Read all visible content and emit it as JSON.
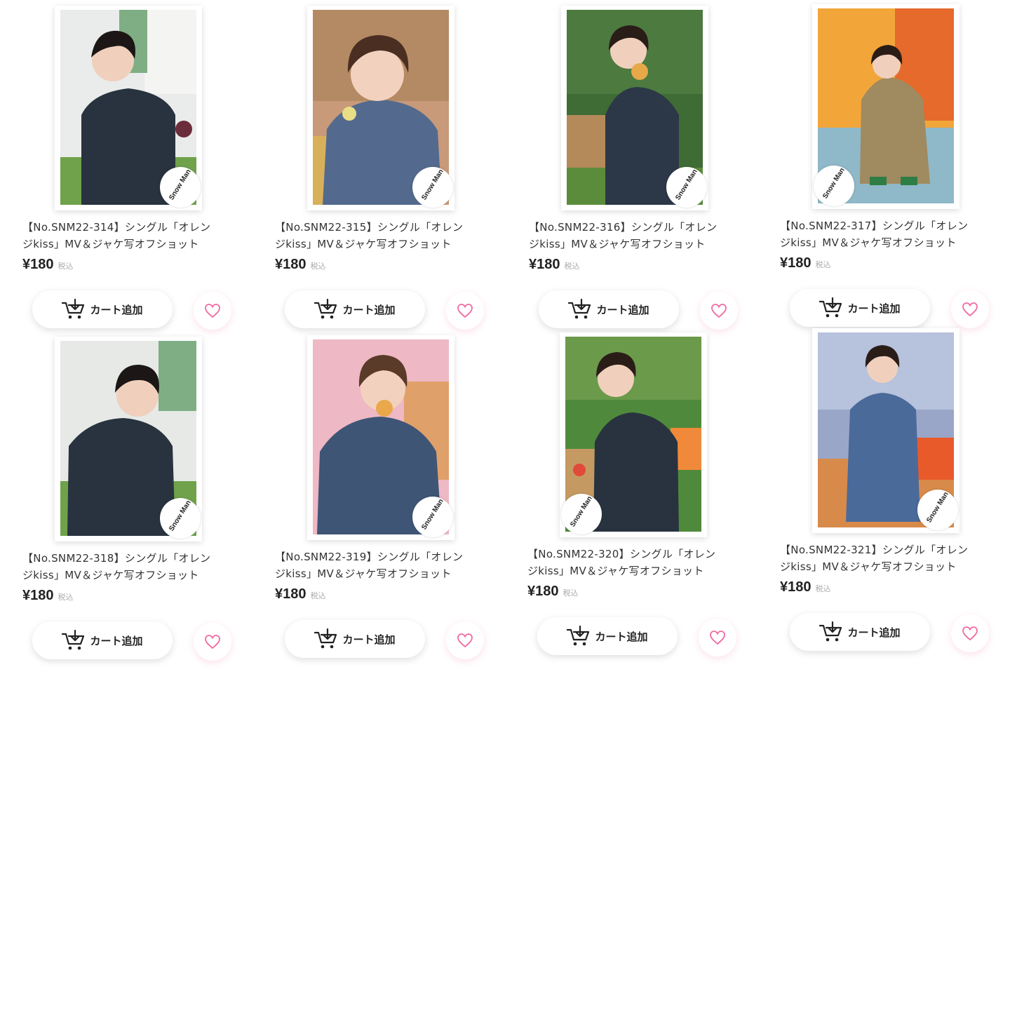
{
  "brand": {
    "logo_text": "Snow Man",
    "accent": "#f06aa2"
  },
  "products": [
    {
      "title_line1": "【No.SNM22-314】シングル「オレン",
      "title_line2": "ジkiss」MV＆ジャケ写オフショット",
      "price": "¥180",
      "tax_label": "税込",
      "cart_label": "カート追加"
    },
    {
      "title_line1": "【No.SNM22-315】シングル「オレン",
      "title_line2": "ジkiss」MV＆ジャケ写オフショット",
      "price": "¥180",
      "tax_label": "税込",
      "cart_label": "カート追加"
    },
    {
      "title_line1": "【No.SNM22-316】シングル「オレン",
      "title_line2": "ジkiss」MV＆ジャケ写オフショット",
      "price": "¥180",
      "tax_label": "税込",
      "cart_label": "カート追加"
    },
    {
      "title_line1": "【No.SNM22-317】シングル「オレン",
      "title_line2": "ジkiss」MV＆ジャケ写オフショット",
      "price": "¥180",
      "tax_label": "税込",
      "cart_label": "カート追加"
    },
    {
      "title_line1": "【No.SNM22-318】シングル「オレン",
      "title_line2": "ジkiss」MV＆ジャケ写オフショット",
      "price": "¥180",
      "tax_label": "税込",
      "cart_label": "カート追加"
    },
    {
      "title_line1": "【No.SNM22-319】シングル「オレン",
      "title_line2": "ジkiss」MV＆ジャケ写オフショット",
      "price": "¥180",
      "tax_label": "税込",
      "cart_label": "カート追加"
    },
    {
      "title_line1": "【No.SNM22-320】シングル「オレン",
      "title_line2": "ジkiss」MV＆ジャケ写オフショット",
      "price": "¥180",
      "tax_label": "税込",
      "cart_label": "カート追加"
    },
    {
      "title_line1": "【No.SNM22-321】シングル「オレン",
      "title_line2": "ジkiss」MV＆ジャケ写オフショット",
      "price": "¥180",
      "tax_label": "税込",
      "cart_label": "カート追加"
    }
  ]
}
